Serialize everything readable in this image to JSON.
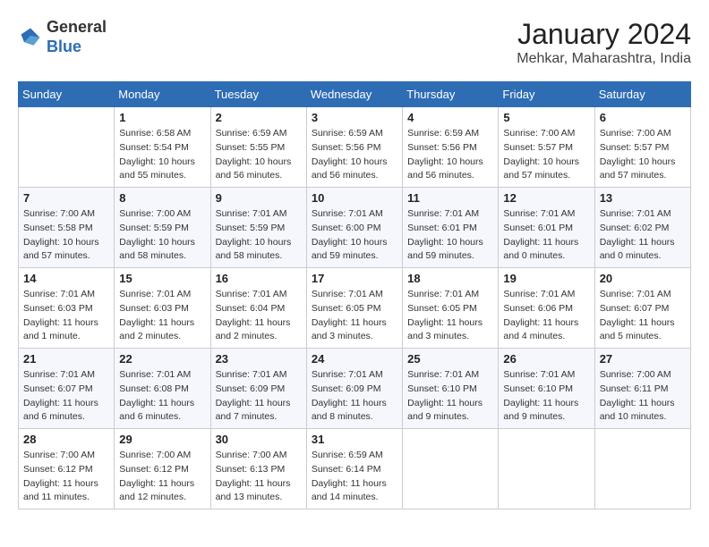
{
  "header": {
    "logo_general": "General",
    "logo_blue": "Blue",
    "month_title": "January 2024",
    "location": "Mehkar, Maharashtra, India"
  },
  "weekdays": [
    "Sunday",
    "Monday",
    "Tuesday",
    "Wednesday",
    "Thursday",
    "Friday",
    "Saturday"
  ],
  "weeks": [
    [
      {
        "day": "",
        "sunrise": "",
        "sunset": "",
        "daylight": ""
      },
      {
        "day": "1",
        "sunrise": "Sunrise: 6:58 AM",
        "sunset": "Sunset: 5:54 PM",
        "daylight": "Daylight: 10 hours and 55 minutes."
      },
      {
        "day": "2",
        "sunrise": "Sunrise: 6:59 AM",
        "sunset": "Sunset: 5:55 PM",
        "daylight": "Daylight: 10 hours and 56 minutes."
      },
      {
        "day": "3",
        "sunrise": "Sunrise: 6:59 AM",
        "sunset": "Sunset: 5:56 PM",
        "daylight": "Daylight: 10 hours and 56 minutes."
      },
      {
        "day": "4",
        "sunrise": "Sunrise: 6:59 AM",
        "sunset": "Sunset: 5:56 PM",
        "daylight": "Daylight: 10 hours and 56 minutes."
      },
      {
        "day": "5",
        "sunrise": "Sunrise: 7:00 AM",
        "sunset": "Sunset: 5:57 PM",
        "daylight": "Daylight: 10 hours and 57 minutes."
      },
      {
        "day": "6",
        "sunrise": "Sunrise: 7:00 AM",
        "sunset": "Sunset: 5:57 PM",
        "daylight": "Daylight: 10 hours and 57 minutes."
      }
    ],
    [
      {
        "day": "7",
        "sunrise": "Sunrise: 7:00 AM",
        "sunset": "Sunset: 5:58 PM",
        "daylight": "Daylight: 10 hours and 57 minutes."
      },
      {
        "day": "8",
        "sunrise": "Sunrise: 7:00 AM",
        "sunset": "Sunset: 5:59 PM",
        "daylight": "Daylight: 10 hours and 58 minutes."
      },
      {
        "day": "9",
        "sunrise": "Sunrise: 7:01 AM",
        "sunset": "Sunset: 5:59 PM",
        "daylight": "Daylight: 10 hours and 58 minutes."
      },
      {
        "day": "10",
        "sunrise": "Sunrise: 7:01 AM",
        "sunset": "Sunset: 6:00 PM",
        "daylight": "Daylight: 10 hours and 59 minutes."
      },
      {
        "day": "11",
        "sunrise": "Sunrise: 7:01 AM",
        "sunset": "Sunset: 6:01 PM",
        "daylight": "Daylight: 10 hours and 59 minutes."
      },
      {
        "day": "12",
        "sunrise": "Sunrise: 7:01 AM",
        "sunset": "Sunset: 6:01 PM",
        "daylight": "Daylight: 11 hours and 0 minutes."
      },
      {
        "day": "13",
        "sunrise": "Sunrise: 7:01 AM",
        "sunset": "Sunset: 6:02 PM",
        "daylight": "Daylight: 11 hours and 0 minutes."
      }
    ],
    [
      {
        "day": "14",
        "sunrise": "Sunrise: 7:01 AM",
        "sunset": "Sunset: 6:03 PM",
        "daylight": "Daylight: 11 hours and 1 minute."
      },
      {
        "day": "15",
        "sunrise": "Sunrise: 7:01 AM",
        "sunset": "Sunset: 6:03 PM",
        "daylight": "Daylight: 11 hours and 2 minutes."
      },
      {
        "day": "16",
        "sunrise": "Sunrise: 7:01 AM",
        "sunset": "Sunset: 6:04 PM",
        "daylight": "Daylight: 11 hours and 2 minutes."
      },
      {
        "day": "17",
        "sunrise": "Sunrise: 7:01 AM",
        "sunset": "Sunset: 6:05 PM",
        "daylight": "Daylight: 11 hours and 3 minutes."
      },
      {
        "day": "18",
        "sunrise": "Sunrise: 7:01 AM",
        "sunset": "Sunset: 6:05 PM",
        "daylight": "Daylight: 11 hours and 3 minutes."
      },
      {
        "day": "19",
        "sunrise": "Sunrise: 7:01 AM",
        "sunset": "Sunset: 6:06 PM",
        "daylight": "Daylight: 11 hours and 4 minutes."
      },
      {
        "day": "20",
        "sunrise": "Sunrise: 7:01 AM",
        "sunset": "Sunset: 6:07 PM",
        "daylight": "Daylight: 11 hours and 5 minutes."
      }
    ],
    [
      {
        "day": "21",
        "sunrise": "Sunrise: 7:01 AM",
        "sunset": "Sunset: 6:07 PM",
        "daylight": "Daylight: 11 hours and 6 minutes."
      },
      {
        "day": "22",
        "sunrise": "Sunrise: 7:01 AM",
        "sunset": "Sunset: 6:08 PM",
        "daylight": "Daylight: 11 hours and 6 minutes."
      },
      {
        "day": "23",
        "sunrise": "Sunrise: 7:01 AM",
        "sunset": "Sunset: 6:09 PM",
        "daylight": "Daylight: 11 hours and 7 minutes."
      },
      {
        "day": "24",
        "sunrise": "Sunrise: 7:01 AM",
        "sunset": "Sunset: 6:09 PM",
        "daylight": "Daylight: 11 hours and 8 minutes."
      },
      {
        "day": "25",
        "sunrise": "Sunrise: 7:01 AM",
        "sunset": "Sunset: 6:10 PM",
        "daylight": "Daylight: 11 hours and 9 minutes."
      },
      {
        "day": "26",
        "sunrise": "Sunrise: 7:01 AM",
        "sunset": "Sunset: 6:10 PM",
        "daylight": "Daylight: 11 hours and 9 minutes."
      },
      {
        "day": "27",
        "sunrise": "Sunrise: 7:00 AM",
        "sunset": "Sunset: 6:11 PM",
        "daylight": "Daylight: 11 hours and 10 minutes."
      }
    ],
    [
      {
        "day": "28",
        "sunrise": "Sunrise: 7:00 AM",
        "sunset": "Sunset: 6:12 PM",
        "daylight": "Daylight: 11 hours and 11 minutes."
      },
      {
        "day": "29",
        "sunrise": "Sunrise: 7:00 AM",
        "sunset": "Sunset: 6:12 PM",
        "daylight": "Daylight: 11 hours and 12 minutes."
      },
      {
        "day": "30",
        "sunrise": "Sunrise: 7:00 AM",
        "sunset": "Sunset: 6:13 PM",
        "daylight": "Daylight: 11 hours and 13 minutes."
      },
      {
        "day": "31",
        "sunrise": "Sunrise: 6:59 AM",
        "sunset": "Sunset: 6:14 PM",
        "daylight": "Daylight: 11 hours and 14 minutes."
      },
      {
        "day": "",
        "sunrise": "",
        "sunset": "",
        "daylight": ""
      },
      {
        "day": "",
        "sunrise": "",
        "sunset": "",
        "daylight": ""
      },
      {
        "day": "",
        "sunrise": "",
        "sunset": "",
        "daylight": ""
      }
    ]
  ]
}
